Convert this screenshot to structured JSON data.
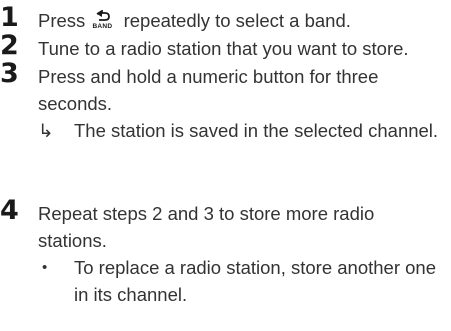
{
  "steps": [
    {
      "number": "1",
      "text_before_icon": "Press",
      "icon": "band-return-icon",
      "icon_label": "BAND",
      "text_after_icon": "repeatedly to select a band."
    },
    {
      "number": "2",
      "text": "Tune to a radio station that you want to store."
    },
    {
      "number": "3",
      "text": "Press and hold a numeric button for three seconds.",
      "result_marker": "↳",
      "result": "The station is saved in the selected channel."
    },
    {
      "number": "4",
      "text": "Repeat steps 2 and 3 to store more radio stations.",
      "bullet_marker": "•",
      "bullet": "To replace a radio station, store another one in its channel."
    }
  ]
}
